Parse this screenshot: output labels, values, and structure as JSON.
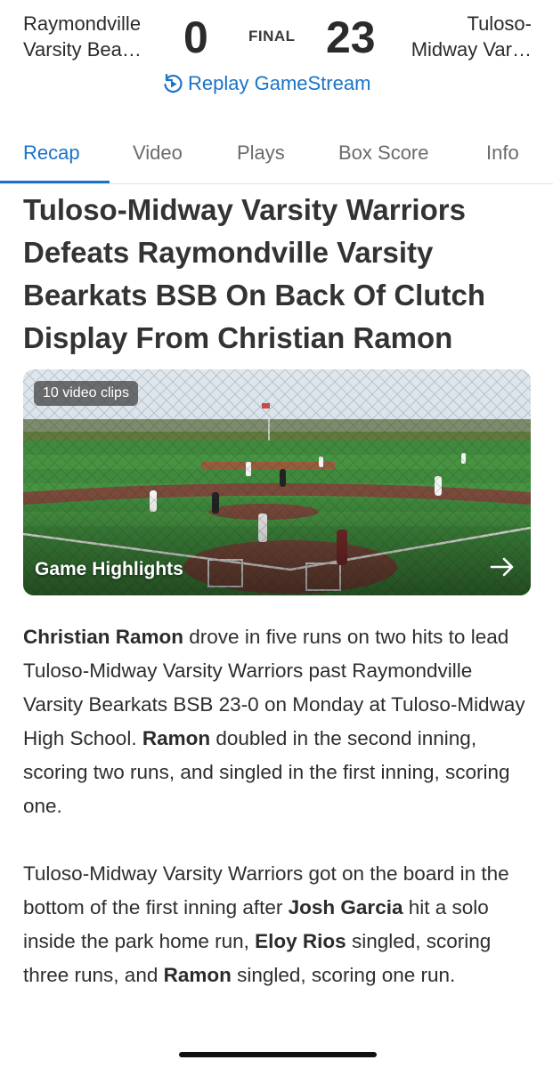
{
  "header": {
    "away_team": {
      "line1": "Raymondville",
      "line2": "Varsity Bea…",
      "score": "0"
    },
    "home_team": {
      "line1": "Tuloso-",
      "line2": "Midway Var…",
      "score": "23"
    },
    "status": "FINAL",
    "replay_label": "Replay GameStream",
    "accent_color": "#1a73c9"
  },
  "tabs": [
    {
      "label": "Recap",
      "active": true
    },
    {
      "label": "Video",
      "active": false
    },
    {
      "label": "Plays",
      "active": false
    },
    {
      "label": "Box Score",
      "active": false
    },
    {
      "label": "Info",
      "active": false
    }
  ],
  "headline": "Tuloso-Midway Varsity Warriors Defeats Raymondville Varsity Bearkats BSB On Back Of Clutch Display From Christian Ramon",
  "video": {
    "clips_badge": "10 video clips",
    "title": "Game Highlights",
    "arrow_icon": "arrow-right-icon"
  },
  "article": {
    "p1": {
      "s1_bold": "Christian Ramon",
      "s1_text": " drove in five runs on two hits to lead Tuloso-Midway Varsity Warriors past Raymondville Varsity Bearkats BSB 23-0 on Monday at Tuloso-Midway High School. ",
      "s2_bold": "Ramon",
      "s2_text": " doubled in the second inning, scoring two runs, and singled in the first inning, scoring one."
    },
    "p2": {
      "t1": "Tuloso-Midway Varsity Warriors got on the board in the bottom of the first inning after ",
      "b1": "Josh Garcia",
      "t2": " hit a solo inside the park home run, ",
      "b2": "Eloy Rios",
      "t3": " singled, scoring three runs, and ",
      "b3": "Ramon",
      "t4": " singled, scoring one run."
    }
  }
}
